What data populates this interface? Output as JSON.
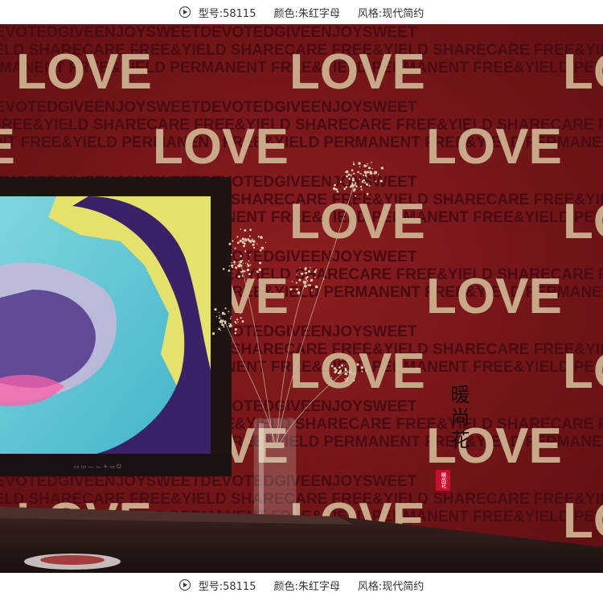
{
  "info": {
    "model": "型号:58115",
    "color": "颜色:朱红字母",
    "style": "风格:现代简约"
  },
  "wallpaper": {
    "big_word": "LOVE",
    "words": [
      "FREE&YIELD",
      "PERMANENT",
      "SHARECARE",
      "DEVOTEDGIVEENJOYSWEET"
    ],
    "background_color": "#7a1519",
    "big_text_color": "#c7a889",
    "small_text_color": "#4a0c10"
  },
  "brand": {
    "seal_text": "暖尚花"
  },
  "colors": {
    "tv_frame": "#1e1513",
    "screen_cyan": "#5ec4d4",
    "screen_purple": "#3a2168",
    "screen_yellow": "#e4e26a",
    "console": "#2a1a18"
  }
}
